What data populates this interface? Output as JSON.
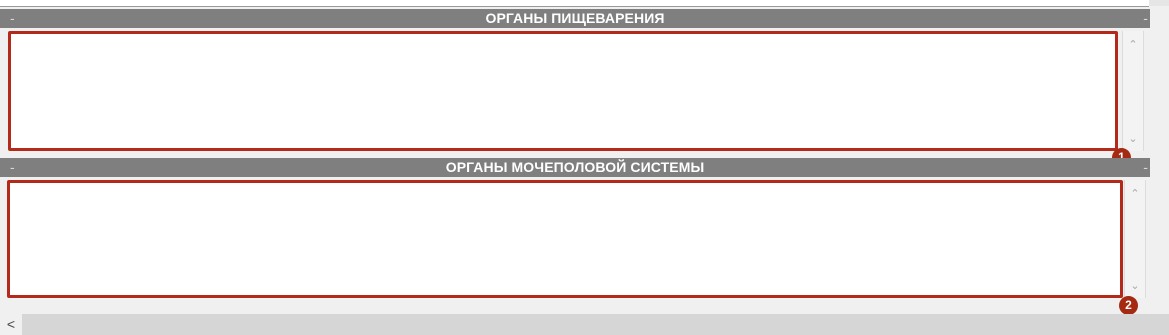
{
  "sections": [
    {
      "title": "ОРГАНЫ ПИЩЕВАРЕНИЯ",
      "value": "",
      "badge": "1"
    },
    {
      "title": "ОРГАНЫ МОЧЕПОЛОВОЙ СИСТЕМЫ",
      "value": "",
      "badge": "2"
    }
  ],
  "header_dash": "-",
  "scroll_arrows": {
    "up": "⌃",
    "down": "⌄",
    "left": "<"
  },
  "colors": {
    "header_bg": "#7f7f7f",
    "highlight_border": "#b42a1a",
    "badge_bg": "#a52a12"
  },
  "icons": {
    "vertical_scroll_up": "chevron-up-icon",
    "vertical_scroll_down": "chevron-down-icon",
    "horizontal_scroll_left": "chevron-left-icon"
  }
}
